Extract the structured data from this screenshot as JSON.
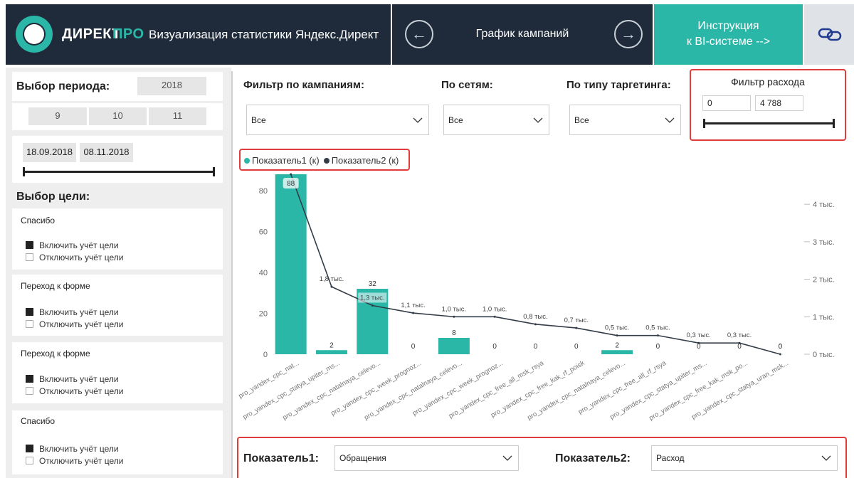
{
  "header": {
    "brand_part1": "ДИРЕКТ",
    "brand_part2": "ПРО",
    "subtitle": "Визуализация статистики Яндекс.Директ",
    "nav_title": "График кампаний",
    "instruction_line1": "Инструкция",
    "instruction_line2": "к BI-системе  -->",
    "colors": {
      "dark": "#1f2b3a",
      "accent": "#2bb7a8"
    }
  },
  "period": {
    "label": "Выбор периода:",
    "year": "2018",
    "months": [
      "9",
      "10",
      "11"
    ],
    "date_start": "18.09.2018",
    "date_end": "08.11.2018"
  },
  "goals": {
    "label": "Выбор цели:",
    "include_label": "Включить учёт цели",
    "exclude_label": "Отключить учёт цели",
    "items": [
      {
        "title": "Спасибо"
      },
      {
        "title": "Переход к форме"
      },
      {
        "title": "Переход к форме"
      },
      {
        "title": "Спасибо"
      }
    ]
  },
  "filters": {
    "campaign_label": "Фильтр по кампаниям:",
    "campaign_value": "Все",
    "network_label": "По сетям:",
    "network_value": "Все",
    "targeting_label": "По типу таргетинга:",
    "targeting_value": "Все",
    "spend_label": "Фильтр расхода",
    "spend_min": "0",
    "spend_max": "4 788"
  },
  "chart_data": {
    "type": "bar+line",
    "categories": [
      "pro_yandex_cpc_nat...",
      "pro_yandex_cpc_statya_upiter_ms...",
      "pro_yandex_cpc_natalnaya_celevo...",
      "pro_yandex_cpc_week_prognoz...",
      "pro_yandex_cpc_natalnaya_celevo...",
      "pro_yandex_cpc_week_prognoz...",
      "pro_yandex_cpc_free_all_msk_rsya",
      "pro_yandex_cpc_free_kak_rf_poisk",
      "pro_yandex_cpc_natalnaya_celevo...",
      "pro_yandex_cpc_free_all_rf_rsya",
      "pro_yandex_cpc_statya_upiter_ms...",
      "pro_yandex_cpc_free_kak_msk_po...",
      "pro_yandex_cpc_statya_uran_msk..."
    ],
    "series": [
      {
        "name": "Показатель1 (к)",
        "color": "#2bb7a8",
        "axis": "left",
        "values": [
          88,
          2,
          32,
          0,
          8,
          0,
          0,
          0,
          2,
          0,
          0,
          0,
          0
        ],
        "labels": [
          "88",
          "2",
          "32",
          "0",
          "8",
          "0",
          "0",
          "0",
          "2",
          "0",
          "0",
          "0",
          "0"
        ]
      },
      {
        "name": "Показатель2 (к)",
        "color": "#333d47",
        "axis": "right",
        "values": [
          4.8,
          1.8,
          1.3,
          1.1,
          1.0,
          1.0,
          0.8,
          0.7,
          0.5,
          0.5,
          0.3,
          0.3,
          0.0
        ],
        "labels": [
          "",
          "1,8 тыс.",
          "1,3 тыс.",
          "1,1 тыс.",
          "1,0 тыс.",
          "1,0 тыс.",
          "0,8 тыс.",
          "0,7 тыс.",
          "0,5 тыс.",
          "0,5 тыс.",
          "0,3 тыс.",
          "0,3 тыс.",
          "0"
        ]
      }
    ],
    "y_left": {
      "ticks": [
        "0",
        "20",
        "40",
        "60",
        "80"
      ],
      "tick_values": [
        0,
        20,
        40,
        60,
        80
      ],
      "lim": [
        0,
        88
      ]
    },
    "y_right": {
      "ticks": [
        "0 тыс.",
        "1 тыс.",
        "2 тыс.",
        "3 тыс.",
        "4 тыс."
      ],
      "tick_values": [
        0,
        1,
        2,
        3,
        4
      ],
      "lim": [
        0,
        4.8
      ]
    },
    "legend_position": "top-left",
    "grid": false
  },
  "bottom": {
    "metric1_label": "Показатель1:",
    "metric1_value": "Обращения",
    "metric2_label": "Показатель2:",
    "metric2_value": "Расход"
  }
}
